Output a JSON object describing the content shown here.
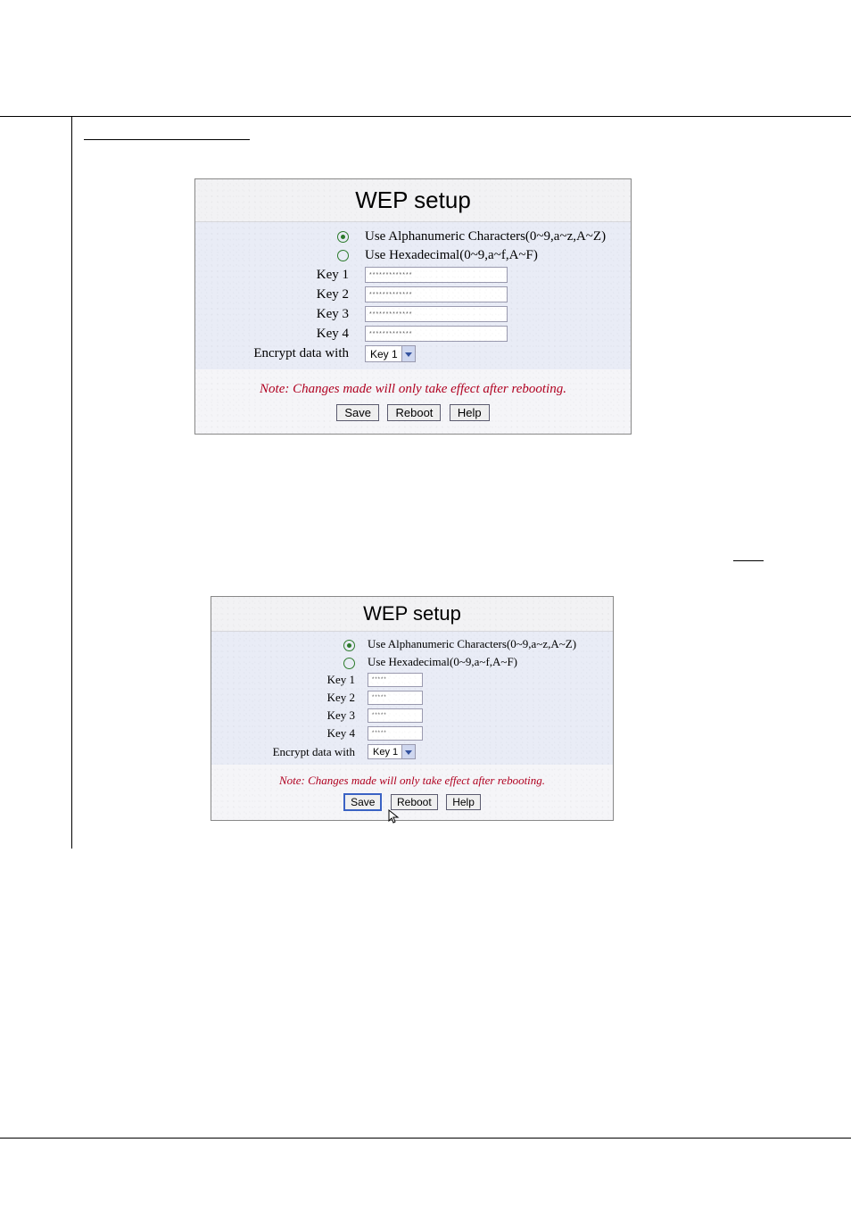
{
  "panel1": {
    "title": "WEP setup",
    "option_alpha": "Use Alphanumeric Characters(0~9,a~z,A~Z)",
    "option_hex": "Use Hexadecimal(0~9,a~f,A~F)",
    "key1_label": "Key 1",
    "key2_label": "Key 2",
    "key3_label": "Key 3",
    "key4_label": "Key 4",
    "key1_value": "*************",
    "key2_value": "*************",
    "key3_value": "*************",
    "key4_value": "*************",
    "encrypt_label": "Encrypt data with",
    "encrypt_value": "Key 1",
    "note": "Note: Changes made will only take effect after rebooting.",
    "save_label": "Save",
    "reboot_label": "Reboot",
    "help_label": "Help"
  },
  "panel2": {
    "title": "WEP setup",
    "option_alpha": "Use Alphanumeric Characters(0~9,a~z,A~Z)",
    "option_hex": "Use Hexadecimal(0~9,a~f,A~F)",
    "key1_label": "Key 1",
    "key2_label": "Key 2",
    "key3_label": "Key 3",
    "key4_label": "Key 4",
    "key1_value": "*****",
    "key2_value": "*****",
    "key3_value": "*****",
    "key4_value": "*****",
    "encrypt_label": "Encrypt data with",
    "encrypt_value": "Key 1",
    "note": "Note: Changes made will only take effect after rebooting.",
    "save_label": "Save",
    "reboot_label": "Reboot",
    "help_label": "Help"
  }
}
